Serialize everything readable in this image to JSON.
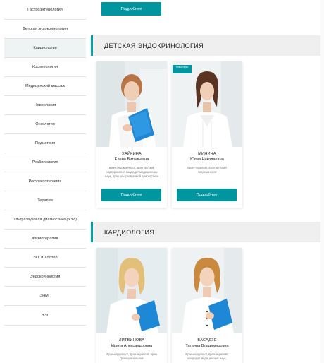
{
  "sidebar": {
    "items": [
      {
        "label": "Гастроэнтерология"
      },
      {
        "label": "Детская эндокринология"
      },
      {
        "label": "Кардиология"
      },
      {
        "label": "Косметология"
      },
      {
        "label": "Медицинский массаж"
      },
      {
        "label": "Неврология"
      },
      {
        "label": "Онкология"
      },
      {
        "label": "Педиатрия"
      },
      {
        "label": "Реабилология"
      },
      {
        "label": "Рефлексотерапия"
      },
      {
        "label": "Терапия"
      },
      {
        "label": "Ультразвуковая диагностика (УЗИ)"
      },
      {
        "label": "Физиотерапия"
      },
      {
        "label": "ЭКГ и Холтер"
      },
      {
        "label": "Эндокринология"
      },
      {
        "label": "ЭНМГ"
      },
      {
        "label": "ЭЭГ"
      }
    ]
  },
  "top_button": {
    "label": "Подробнее"
  },
  "sections": [
    {
      "title": "ДЕТСКАЯ ЭНДОКРИНОЛОГИЯ",
      "doctors": [
        {
          "surname": "ХАЙКИНА",
          "name": "Елена Витальевна",
          "spec": "Врач эндокринолог, врач детский эндокринолог, кандидат медицинских наук, врач ультразвуковой диагностики",
          "button": "Подробнее"
        },
        {
          "surname": "МИНИНА",
          "name": "Юлия Николаевна",
          "spec": "Врач-терапевт, врач детский эндокринолог",
          "button": "Подробнее",
          "badge": "Новый врач"
        }
      ]
    },
    {
      "title": "КАРДИОЛОГИЯ",
      "doctors": [
        {
          "surname": "ЛИТВИНОВА",
          "name": "Ирина Александровна",
          "spec": "Врач-кардиолог, врач-терапевт, врач функциональной",
          "button": "Подробнее"
        },
        {
          "surname": "ВАСАДЗЕ",
          "name": "Татьяна Владимировна",
          "spec": "Врач-кардиолог, врач-терапевт, кандидат медицинских наук,",
          "button": "Подробнее"
        }
      ]
    }
  ],
  "colors": {
    "accent": "#00959f",
    "header_bg": "#efefef"
  }
}
